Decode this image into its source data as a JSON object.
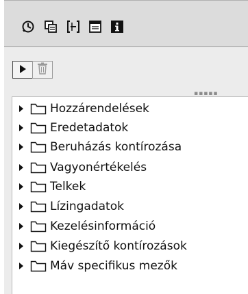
{
  "toolbar": {
    "icons": [
      {
        "name": "clock-icon",
        "title": ""
      },
      {
        "name": "copy-icon",
        "title": ""
      },
      {
        "name": "collapse-icon",
        "title": ""
      },
      {
        "name": "layout-icon",
        "title": ""
      },
      {
        "name": "info-icon",
        "title": ""
      }
    ]
  },
  "actions": {
    "execute": {
      "icon": "play-icon"
    },
    "delete": {
      "icon": "trash-icon",
      "enabled": false
    }
  },
  "tree": {
    "nodes": [
      {
        "label": "Hozzárendelések",
        "icon": "folder-icon",
        "expanded": false
      },
      {
        "label": "Eredetadatok",
        "icon": "folder-icon",
        "expanded": false
      },
      {
        "label": "Beruházás kontírozása",
        "icon": "folder-icon",
        "expanded": false
      },
      {
        "label": "Vagyonértékelés",
        "icon": "folder-icon",
        "expanded": false
      },
      {
        "label": "Telkek",
        "icon": "folder-icon",
        "expanded": false
      },
      {
        "label": "Lízingadatok",
        "icon": "folder-icon",
        "expanded": false
      },
      {
        "label": "Kezelésinformáció",
        "icon": "folder-icon",
        "expanded": false
      },
      {
        "label": "Kiegészítő kontírozások",
        "icon": "folder-icon",
        "expanded": false
      },
      {
        "label": "Máv specifikus mezők",
        "icon": "folder-icon",
        "expanded": false
      }
    ]
  }
}
